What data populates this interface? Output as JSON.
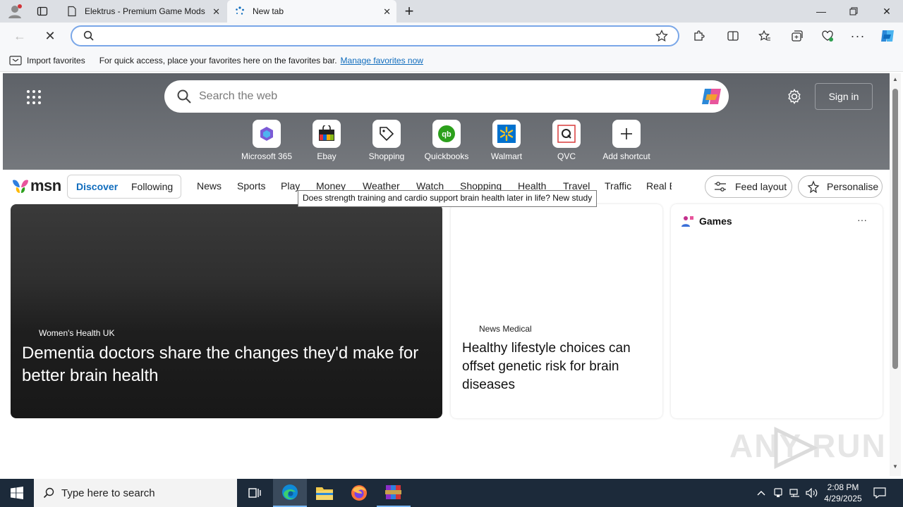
{
  "tabs": [
    {
      "title": "Elektrus - Premium Game Mods |",
      "active": false
    },
    {
      "title": "New tab",
      "active": true
    }
  ],
  "address": {
    "value": "",
    "placeholder": ""
  },
  "favorites_bar": {
    "import_label": "Import favorites",
    "hint": "For quick access, place your favorites here on the favorites bar.",
    "manage_link": "Manage favorites now"
  },
  "newtab": {
    "search_placeholder": "Search the web",
    "sign_in": "Sign in",
    "shortcuts": [
      {
        "label": "Microsoft 365",
        "icon": "microsoft365-icon"
      },
      {
        "label": "Ebay",
        "icon": "ebay-icon"
      },
      {
        "label": "Shopping",
        "icon": "shopping-tag-icon"
      },
      {
        "label": "Quickbooks",
        "icon": "quickbooks-icon"
      },
      {
        "label": "Walmart",
        "icon": "walmart-icon"
      },
      {
        "label": "QVC",
        "icon": "qvc-icon"
      },
      {
        "label": "Add shortcut",
        "icon": "plus-icon"
      }
    ]
  },
  "msn": {
    "logo": "msn",
    "toggle": [
      "Discover",
      "Following"
    ],
    "nav": [
      "News",
      "Sports",
      "Play",
      "Money",
      "Weather",
      "Watch",
      "Shopping",
      "Health",
      "Travel",
      "Traffic",
      "Real E"
    ],
    "feed_layout": "Feed layout",
    "personalise": "Personalise",
    "tooltip": "Does strength training and cardio support brain health later in life? New study",
    "hero_card": {
      "source": "Women's Health UK",
      "title": "Dementia doctors share the changes they'd make for better brain health"
    },
    "mid_card": {
      "source": "News Medical",
      "title": "Healthy lifestyle choices can offset genetic risk for brain diseases"
    },
    "games_card": {
      "title": "Games",
      "menu": "···"
    }
  },
  "watermark": "ANY RUN",
  "taskbar": {
    "search_placeholder": "Type here to search",
    "time": "2:08 PM",
    "date": "4/29/2025"
  },
  "colors": {
    "accent": "#0f6cbd",
    "tab_strip": "#dcdfe4",
    "taskbar": "#1c2a3a"
  }
}
